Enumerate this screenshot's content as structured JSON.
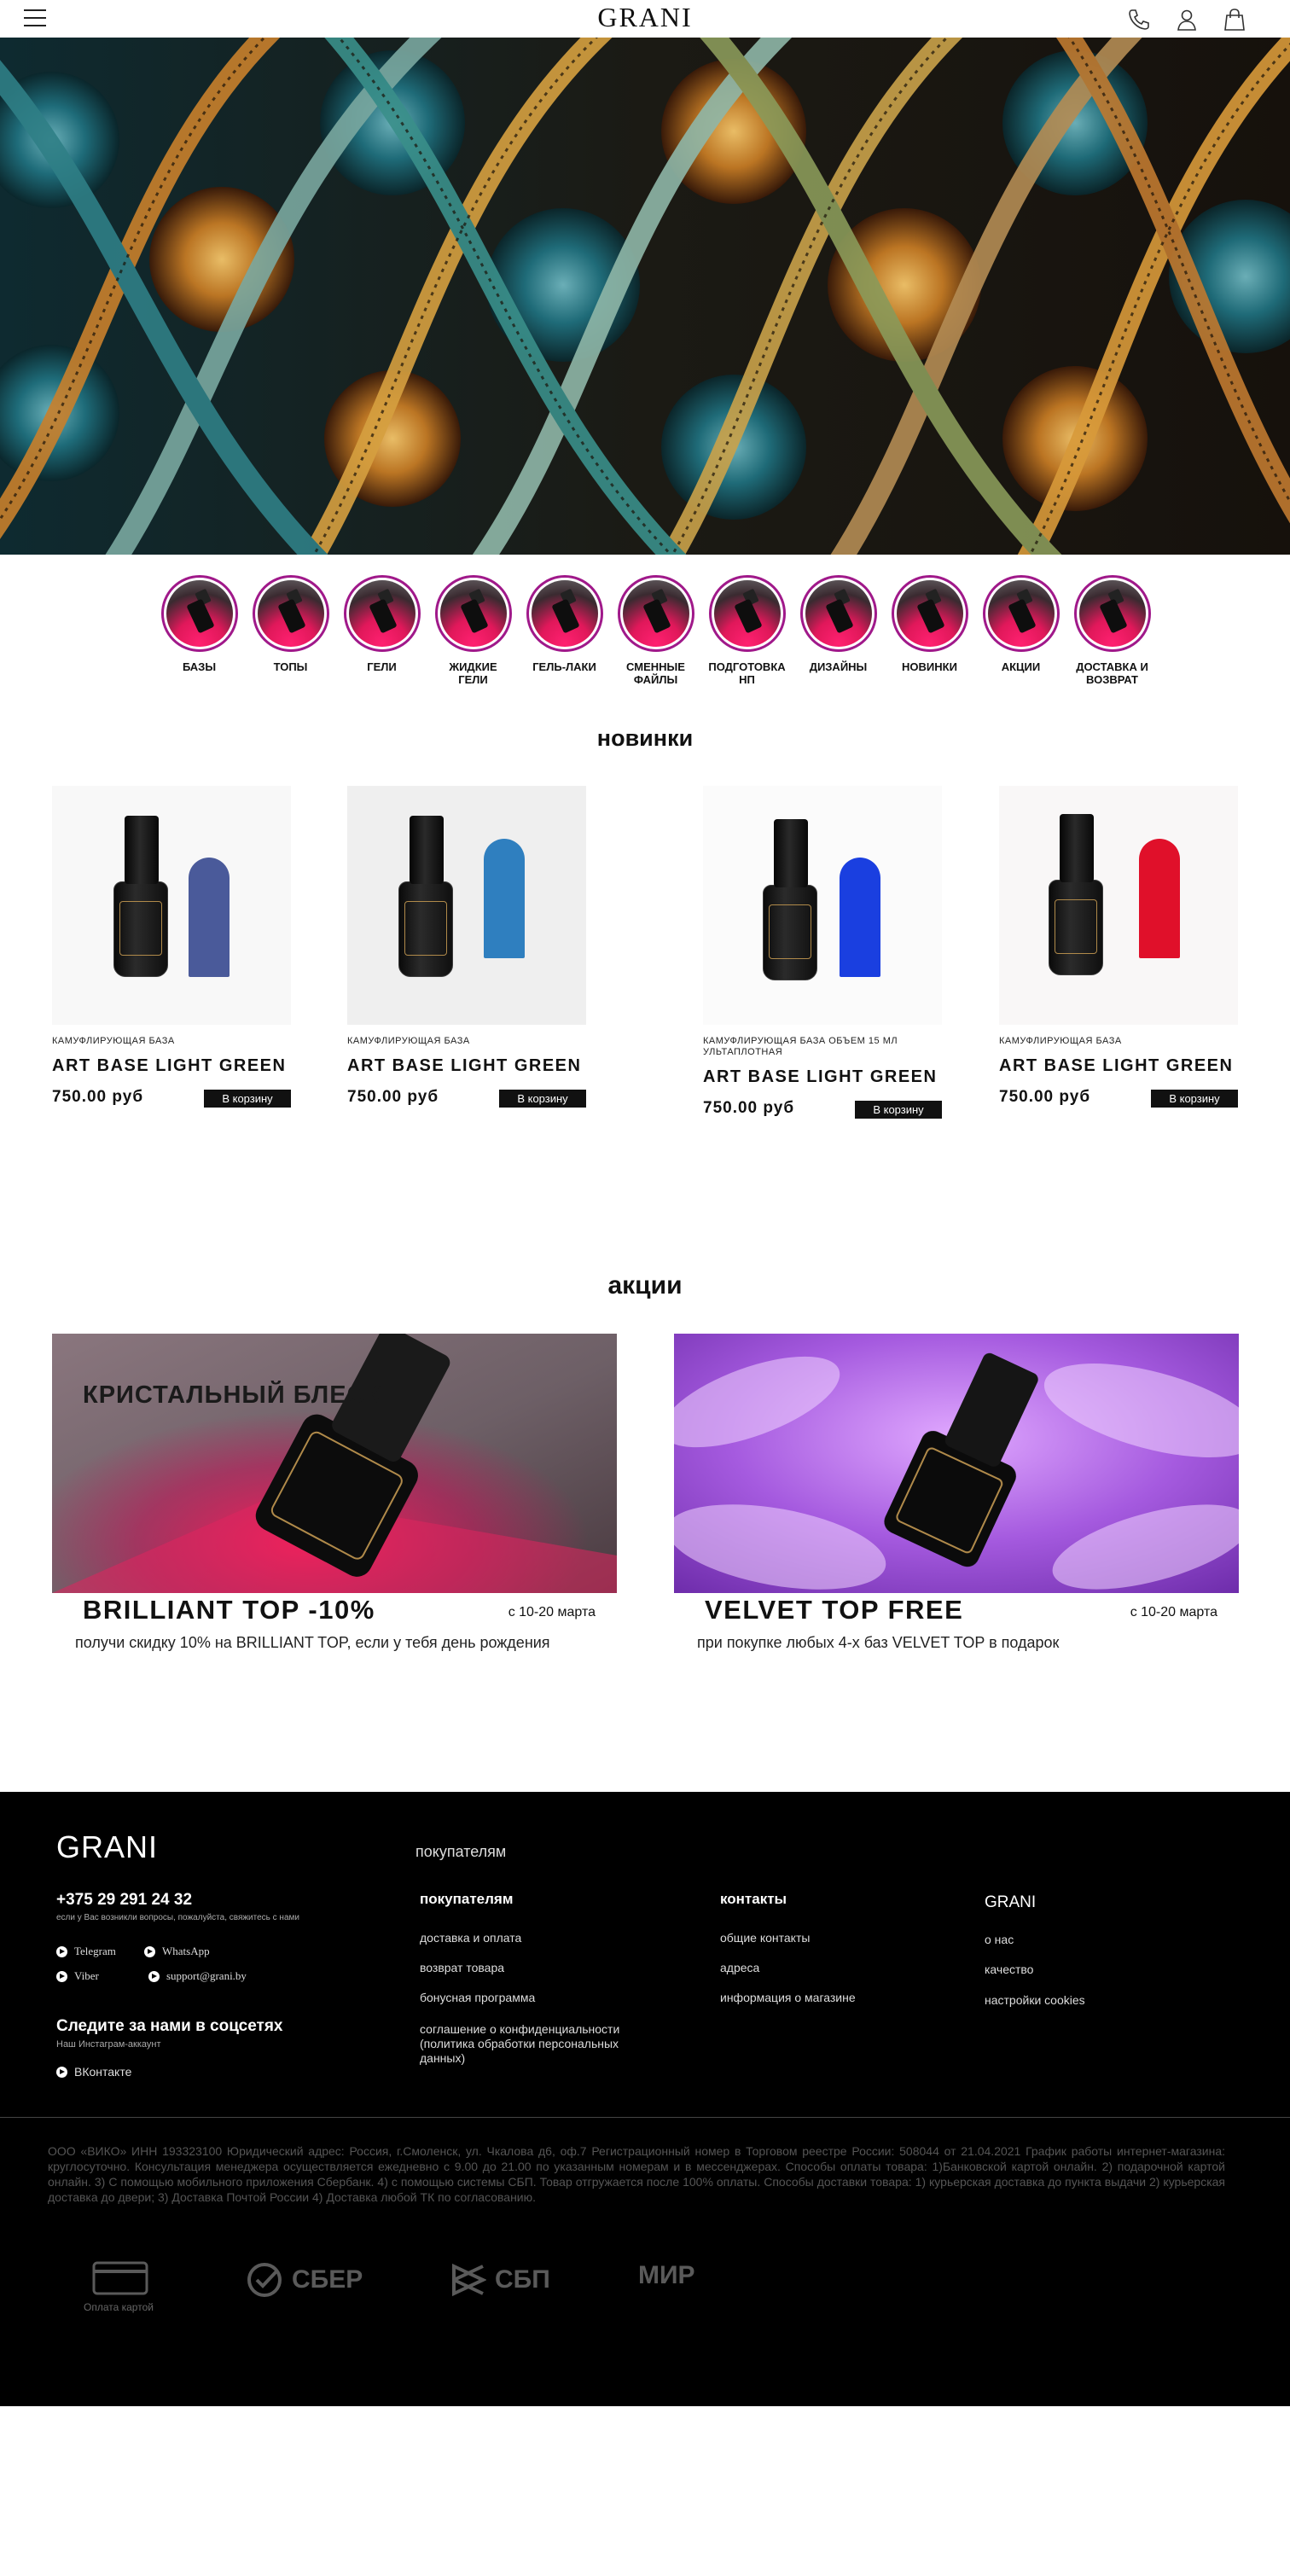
{
  "header": {
    "logo": "GRANI",
    "icons": [
      "menu-icon",
      "phone-icon",
      "user-icon",
      "bag-icon"
    ]
  },
  "categories": [
    {
      "label": "БАЗЫ"
    },
    {
      "label": "ТОПЫ"
    },
    {
      "label": "ГЕЛИ"
    },
    {
      "label": "ЖИДКИЕ\nГЕЛИ"
    },
    {
      "label": "ГЕЛЬ-ЛАКИ"
    },
    {
      "label": "СМЕННЫЕ\nФАЙЛЫ"
    },
    {
      "label": "ПОДГОТОВКА\nНП"
    },
    {
      "label": "ДИЗАЙНЫ"
    },
    {
      "label": "НОВИНКИ"
    },
    {
      "label": "АКЦИИ"
    },
    {
      "label": "ДОСТАВКА И\nВОЗВРАТ"
    }
  ],
  "new_section": {
    "title": "новинки",
    "products": [
      {
        "subtitle": "КАМУФЛИРУЮЩАЯ БАЗА",
        "name": "ART BASE  LIGHT GREEN",
        "price": "750.00 руб",
        "cart_label": "В корзину",
        "nail_color": "#4a5a9a"
      },
      {
        "subtitle": "КАМУФЛИРУЮЩАЯ БАЗА",
        "name": "ART BASE  LIGHT GREEN",
        "price": "750.00 руб",
        "cart_label": "В корзину",
        "nail_color": "#2f7fbf"
      },
      {
        "subtitle": "КАМУФЛИРУЮЩАЯ БАЗА ОБЪЕМ 15 МЛ УЛЬТАПЛОТНАЯ",
        "name": "ART BASE  LIGHT GREEN",
        "price": "750.00 руб",
        "cart_label": "В корзину",
        "nail_color": "#1a3fe0"
      },
      {
        "subtitle": "КАМУФЛИРУЮЩАЯ БАЗА",
        "name": "ART BASE  LIGHT GREEN",
        "price": "750.00 руб",
        "cart_label": "В корзину",
        "nail_color": "#e0102a"
      }
    ]
  },
  "promo_section": {
    "title": "акции",
    "promos": [
      {
        "image_text": "КРИСТАЛЬНЫЙ БЛЕСК",
        "title": "BRILLIANT TOP -10%",
        "date": "с 10-20 марта",
        "description": "получи скидку 10% на BRILLIANT TOP, если у тебя день рождения"
      },
      {
        "image_text": "",
        "title": "VELVET TOP FREE",
        "date": "с 10-20 марта",
        "description": "при покупке любых 4-х баз VELVET TOP в подарок"
      }
    ]
  },
  "footer": {
    "logo": "GRANI",
    "phone": "+375 29 291 24 32",
    "phone_note": "если у Вас возникли вопросы, пожалуйста, свяжитесь с нами",
    "messengers": {
      "telegram": "Telegram",
      "whatsapp": "WhatsApp",
      "viber": "Viber",
      "email": "support@grani.by"
    },
    "social_title": "Следите за нами в соцсетях",
    "social_note": "Наш Инстаграм-аккаунт",
    "vk": "ВКонтакте",
    "breadcrumb_label": "покупателям",
    "col_buyers": {
      "title": "покупателям",
      "links": [
        "доставка и оплата",
        "возврат товара",
        "бонусная программа",
        "соглашение о конфиденциальности (политика обработки персональных данных)"
      ]
    },
    "col_contacts": {
      "title": "контакты",
      "links": [
        "общие контакты",
        "адреса",
        "информация о магазине"
      ]
    },
    "col_grani": {
      "title": "GRANI",
      "links": [
        "о нас",
        "качество",
        "настройки cookies"
      ]
    },
    "legal": "ООО «ВИКО» ИНН 193323100 Юридический адрес: Россия, г.Смоленск, ул. Чкалова д6, оф.7 Регистрационный номер в Торговом реестре России: 508044 от 21.04.2021 График работы интернет-магазина: круглосуточно. Консультация менеджера осуществляется ежедневно с 9.00 до 21.00 по указанным номерам и в мессенджерах. Способы оплаты товара: 1)Банковской картой онлайн. 2) подарочной картой онлайн. 3) С помощью мобильного приложения Сбербанк. 4) с помощью системы СБП. Товар отгружается после 100% оплаты.  Способы доставки товара: 1) курьерская доставка до пункта выдачи 2) курьерская доставка до двери; 3) Доставка Почтой России 4) Доставка любой ТК по согласованию.",
    "payments": {
      "card_note": "Оплата картой",
      "sber": "СБЕР",
      "sbp": "СБП",
      "mir": "МИР"
    }
  }
}
